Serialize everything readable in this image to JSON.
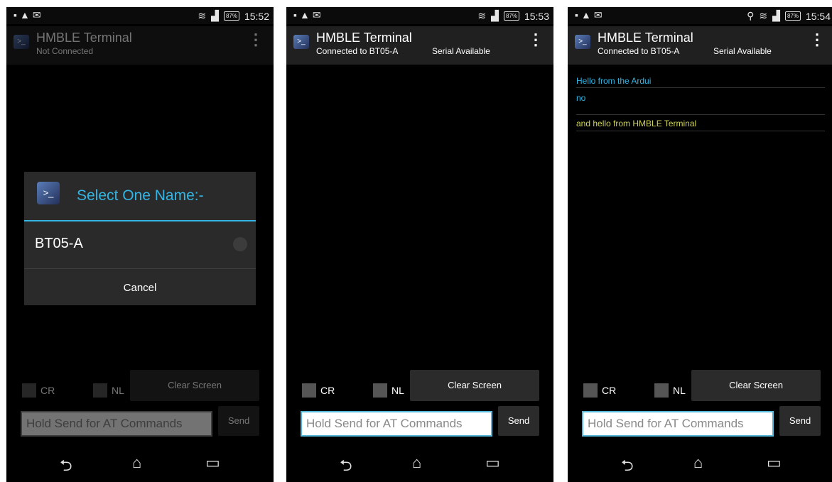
{
  "screens": [
    {
      "status_time": "15:52",
      "title": "HMBLE Terminal",
      "subtitle": "Not Connected",
      "serial": "",
      "dialog": {
        "title": "Select One Name:-",
        "item": "BT05-A",
        "cancel": "Cancel"
      },
      "cr": "CR",
      "nl": "NL",
      "clear": "Clear Screen",
      "input_placeholder": "Hold Send for AT Commands",
      "send": "Send"
    },
    {
      "status_time": "15:53",
      "title": "HMBLE Terminal",
      "subtitle": "Connected to BT05-A",
      "serial": "Serial Available",
      "cr": "CR",
      "nl": "NL",
      "clear": "Clear Screen",
      "input_placeholder": "Hold Send for AT Commands",
      "send": "Send"
    },
    {
      "status_time": "15:54",
      "title": "HMBLE Terminal",
      "subtitle": "Connected to BT05-A",
      "serial": "Serial Available",
      "messages": [
        {
          "text": "Hello from the Ardui",
          "color": "#33b5e5"
        },
        {
          "text": "no",
          "color": "#33b5e5"
        },
        {
          "text": "and hello from HMBLE Terminal",
          "color": "#cfd35a"
        }
      ],
      "cr": "CR",
      "nl": "NL",
      "clear": "Clear Screen",
      "input_placeholder": "Hold Send for AT Commands",
      "send": "Send"
    }
  ],
  "status_battery": "87%",
  "icons": [
    "notification-icon",
    "warning-icon",
    "mail-icon",
    "wifi-icon",
    "signal-icon",
    "battery-icon",
    "menu-icon",
    "back-icon",
    "home-icon",
    "recents-icon",
    "location-icon"
  ]
}
